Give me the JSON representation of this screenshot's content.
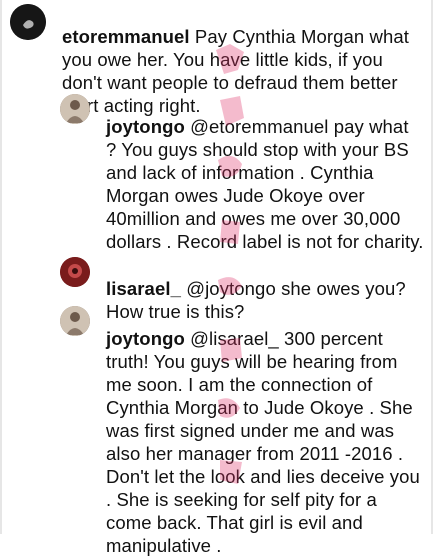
{
  "comments": [
    {
      "username": "etoremmanuel",
      "text": " Pay Cynthia Morgan what you owe her. You have little kids, if you don't want people to defraud them better start acting right."
    },
    {
      "username": "joytongo",
      "text": " @etoremmanuel pay what ? You guys should stop with your BS and lack of information . Cynthia Morgan owes Jude Okoye over 40million and owes me over 30,000  dollars . Record label is not for charity."
    },
    {
      "username": "lisarael_",
      "text": " @joytongo she owes you? How true is this?"
    },
    {
      "username": "joytongo",
      "text": " @lisarael_ 300 percent truth! You guys will be hearing from me soon. I am the connection of Cynthia Morgan to Jude Okoye . She was first signed under me and was also her manager from 2011 -2016 . Don't let the look and lies deceive you . She is seeking  for self pity for a come back. That girl is evil and manipulative ."
    }
  ]
}
